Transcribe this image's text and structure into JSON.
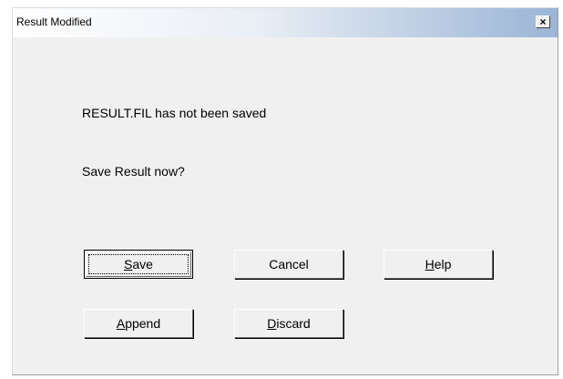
{
  "window": {
    "title": "Result Modified",
    "close_glyph": "×"
  },
  "message": {
    "line1": "RESULT.FIL has not been saved",
    "line2": "Save Result now?"
  },
  "buttons": {
    "save": {
      "mnemonic": "S",
      "rest": "ave"
    },
    "cancel": {
      "label": "Cancel"
    },
    "help": {
      "mnemonic": "H",
      "rest": "elp"
    },
    "append": {
      "mnemonic": "A",
      "rest": "ppend"
    },
    "discard": {
      "mnemonic": "D",
      "rest": "iscard"
    }
  },
  "colors": {
    "dialog_bg": "#f0f0f0",
    "title_gradient_end": "#9ab5d6"
  }
}
